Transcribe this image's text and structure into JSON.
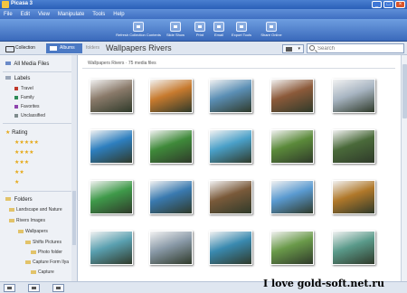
{
  "window": {
    "title": "Picasa 3"
  },
  "menu": [
    "File",
    "Edit",
    "View",
    "Manipulate",
    "Tools",
    "Help"
  ],
  "toolbar": {
    "buttons": [
      {
        "label": "Refresh Collection Contents"
      },
      {
        "label": "Slide Show"
      },
      {
        "label": "Print"
      },
      {
        "label": "Email"
      },
      {
        "label": "Export Tools"
      },
      {
        "label": "Share Online"
      }
    ]
  },
  "tabs": {
    "collection": "Collection",
    "albums": "Albums"
  },
  "pathbar": {
    "prefix": "folders",
    "title": "Wallpapers Rivers"
  },
  "search": {
    "placeholder": "Search"
  },
  "sidebar": {
    "all_media": "All Media Files",
    "labels_head": "Labels",
    "labels": [
      {
        "name": "Travel",
        "color": "#c0392b"
      },
      {
        "name": "Family",
        "color": "#2e8b57"
      },
      {
        "name": "Favorites",
        "color": "#8e44ad"
      },
      {
        "name": "Unclassified",
        "color": "#7f8c8d"
      }
    ],
    "rating_head": "Rating",
    "ratings": [
      "★★★★★",
      "★★★★",
      "★★★",
      "★★",
      "★"
    ],
    "folders_head": "Folders",
    "folders": [
      "Landscape and Nature",
      "Rivers Images",
      "Wallpapers",
      "Shifts Pictures",
      "Photo folder",
      "Capture Form Ilya",
      "Capture"
    ]
  },
  "content": {
    "breadcrumb": "Wallpapers Rivers · 75 media files",
    "thumbs": [
      "#8a7a6a",
      "#c77a2e",
      "#5b8fb5",
      "#8c5a3a",
      "#a8b5c2",
      "#2e7fbf",
      "#3f8a3a",
      "#4aa0c8",
      "#5b8a3a",
      "#4a6a3a",
      "#3f9a4a",
      "#3a7ab0",
      "#7a5a3a",
      "#5a9ad0",
      "#b0782a",
      "#5aa0b0",
      "#8a9aa8",
      "#3a8ab0",
      "#6a9a4a",
      "#5a9a8a"
    ]
  },
  "watermark": "I love gold-soft.net.ru"
}
